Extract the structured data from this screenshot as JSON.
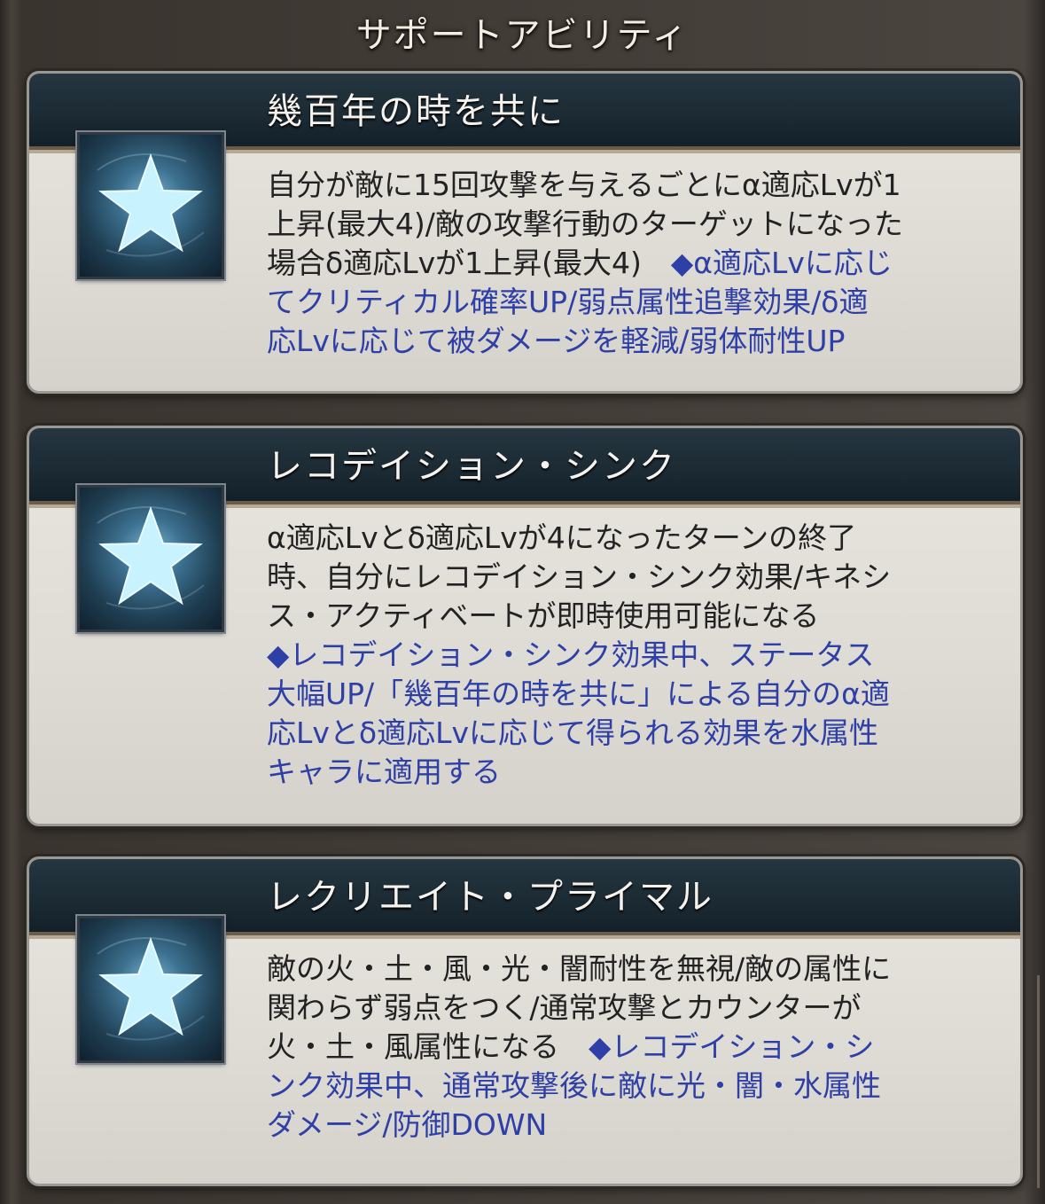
{
  "header": {
    "title": "サポートアビリティ"
  },
  "abilities": [
    {
      "name": "幾百年の時を共に",
      "icon": "star-icon",
      "lines": [
        [
          {
            "t": "自分が敵に15回攻撃を与えるごとにα適応Lvが1",
            "c": "normal"
          }
        ],
        [
          {
            "t": "上昇(最大4)/敵の攻撃行動のターゲットになった",
            "c": "normal"
          }
        ],
        [
          {
            "t": "場合δ適応Lvが1上昇(最大4)　",
            "c": "normal"
          },
          {
            "t": "◆α適応Lvに応じ",
            "c": "blue"
          }
        ],
        [
          {
            "t": "てクリティカル確率UP/弱点属性追撃効果/δ適",
            "c": "blue"
          }
        ],
        [
          {
            "t": "応Lvに応じて被ダメージを軽減/弱体耐性UP",
            "c": "blue"
          }
        ]
      ]
    },
    {
      "name": "レコデイション・シンク",
      "icon": "star-icon",
      "lines": [
        [
          {
            "t": "α適応Lvとδ適応Lvが4になったターンの終了",
            "c": "normal"
          }
        ],
        [
          {
            "t": "時、自分にレコデイション・シンク効果/キネシ",
            "c": "normal"
          }
        ],
        [
          {
            "t": "ス・アクティベートが即時使用可能になる",
            "c": "normal"
          }
        ],
        [
          {
            "t": "◆レコデイション・シンク効果中、ステータス",
            "c": "blue"
          }
        ],
        [
          {
            "t": "大幅UP/「幾百年の時を共に」による自分のα適",
            "c": "blue"
          }
        ],
        [
          {
            "t": "応Lvとδ適応Lvに応じて得られる効果を水属性",
            "c": "blue"
          }
        ],
        [
          {
            "t": "キャラに適用する",
            "c": "blue"
          }
        ]
      ]
    },
    {
      "name": "レクリエイト・プライマル",
      "icon": "star-icon",
      "lines": [
        [
          {
            "t": "敵の火・土・風・光・闇耐性を無視/敵の属性に",
            "c": "normal"
          }
        ],
        [
          {
            "t": "関わらず弱点をつく/通常攻撃とカウンターが",
            "c": "normal"
          }
        ],
        [
          {
            "t": "火・土・風属性になる　",
            "c": "normal"
          },
          {
            "t": "◆レコデイション・シ",
            "c": "blue"
          }
        ],
        [
          {
            "t": "ンク効果中、通常攻撃後に敵に光・闇・水属性",
            "c": "blue"
          }
        ],
        [
          {
            "t": "ダメージ/防御DOWN",
            "c": "blue"
          }
        ]
      ]
    }
  ]
}
